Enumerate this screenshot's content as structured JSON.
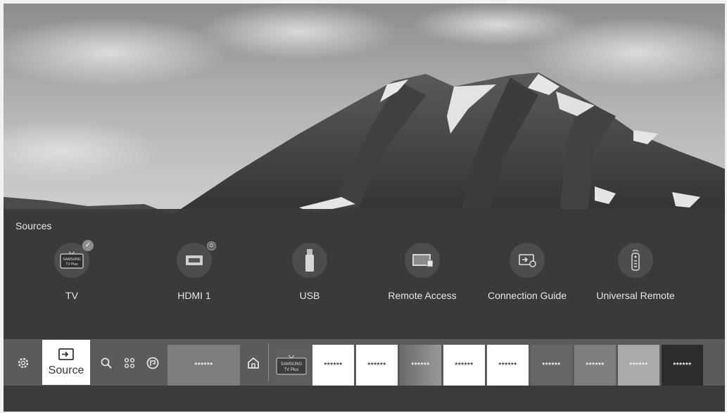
{
  "sources": {
    "title": "Sources",
    "items": [
      {
        "label": "TV",
        "icon": "samsung-tv-plus-icon"
      },
      {
        "label": "HDMI 1",
        "icon": "hdmi-icon"
      },
      {
        "label": "USB",
        "icon": "usb-icon"
      },
      {
        "label": "Remote Access",
        "icon": "remote-access-icon"
      },
      {
        "label": "Connection Guide",
        "icon": "connection-guide-icon"
      },
      {
        "label": "Universal Remote",
        "icon": "universal-remote-icon"
      }
    ],
    "tv_logo_top": "SAMSUNG",
    "tv_logo_bottom": "TV Plus"
  },
  "bar": {
    "settings_icon": "gear-icon",
    "source_label": "Source",
    "search_icon": "search-icon",
    "apps_icon": "apps-icon",
    "ambient_icon": "ambient-icon",
    "wide_tile": "******",
    "home_icon": "home-icon",
    "tv_plus_top": "SAMSUNG",
    "tv_plus_bottom": "TV Plus",
    "tiles": [
      "******",
      "******",
      "******",
      "******",
      "******",
      "******",
      "******",
      "******",
      "******"
    ]
  },
  "colors": {
    "panel": "#3a3a3a",
    "bar": "#5b5b5b",
    "tile_white": "#ffffff"
  }
}
